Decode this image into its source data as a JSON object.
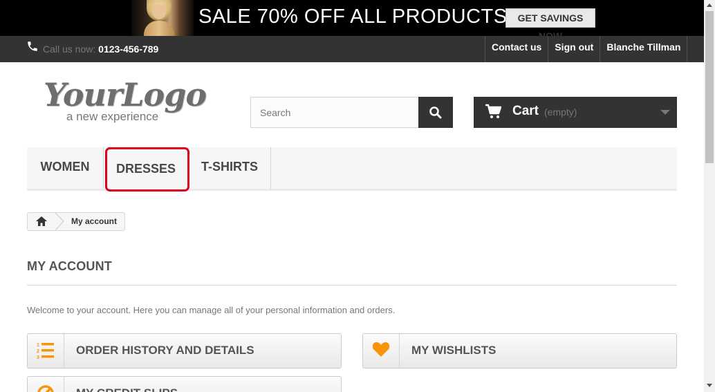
{
  "banner": {
    "text": "SALE 70% OFF ALL PRODUCTS",
    "button": "GET SAVINGS NOW"
  },
  "nav": {
    "phone_label": "Call us now:",
    "phone_number": "0123-456-789",
    "links": [
      "Contact us",
      "Sign out",
      "Blanche Tillman"
    ]
  },
  "logo": {
    "main": "YourLogo",
    "sub": "a new experience"
  },
  "search": {
    "placeholder": "Search"
  },
  "cart": {
    "label": "Cart",
    "status": "(empty)"
  },
  "menu": {
    "items": [
      "WOMEN",
      "DRESSES",
      "T-SHIRTS"
    ]
  },
  "breadcrumb": {
    "current": "My account"
  },
  "main": {
    "heading": "MY ACCOUNT",
    "welcome": "Welcome to your account. Here you can manage all of your personal information and orders.",
    "buttons": [
      "ORDER HISTORY AND DETAILS",
      "MY WISHLISTS",
      "MY CREDIT SLIPS"
    ]
  },
  "colors": {
    "accent": "#f89406",
    "highlight": "#e0001b",
    "dark": "#333333"
  }
}
